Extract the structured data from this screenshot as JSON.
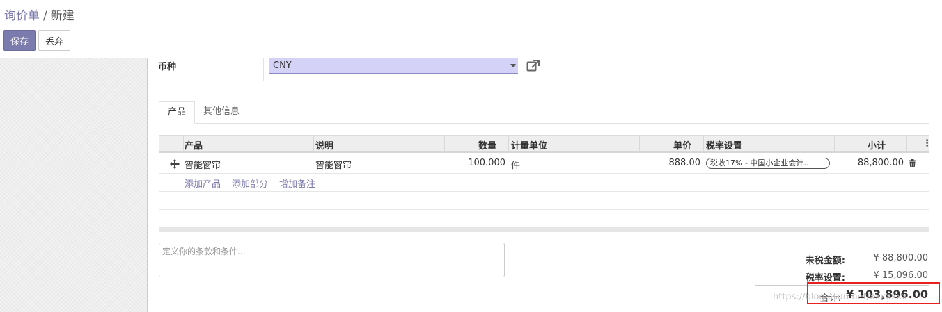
{
  "breadcrumb": {
    "parent": "询价单",
    "separator": "/",
    "current": "新建"
  },
  "buttons": {
    "save": "保存",
    "discard": "丢弃"
  },
  "currency": {
    "label": "币种",
    "value": "CNY"
  },
  "tabs": [
    {
      "label": "产品"
    },
    {
      "label": "其他信息"
    }
  ],
  "table": {
    "headers": {
      "product": "产品",
      "description": "说明",
      "quantity": "数量",
      "uom": "计量单位",
      "unit_price": "单价",
      "taxes": "税率设置",
      "subtotal": "小计",
      "options": "⋮"
    },
    "rows": [
      {
        "product": "智能窗帘",
        "description": "智能窗帘",
        "quantity": "100.000",
        "uom": "件",
        "unit_price": "888.00",
        "tax": "税收17% - 中国小企业会计…",
        "subtotal": "88,800.00"
      }
    ],
    "add_links": {
      "add_product": "添加产品",
      "add_section": "添加部分",
      "add_note": "增加备注"
    }
  },
  "notes": {
    "placeholder": "定义你的条款和条件..."
  },
  "totals": {
    "untaxed_label": "未税金额:",
    "untaxed_value": "¥ 88,800.00",
    "taxes_label": "税率设置:",
    "taxes_value": "¥ 15,096.00",
    "total_label": "合计:",
    "total_value": "¥ 103,896.00"
  },
  "watermark": "https://blog.csdn.net/xxxxxxx",
  "colors": {
    "primary": "#7c7bad",
    "select_bg": "#d4d2f6",
    "highlight_box": "#e8201f"
  },
  "icons": {
    "external_link": "external-link-icon",
    "drag_handle": "drag-handle-icon",
    "delete": "trash-icon"
  }
}
